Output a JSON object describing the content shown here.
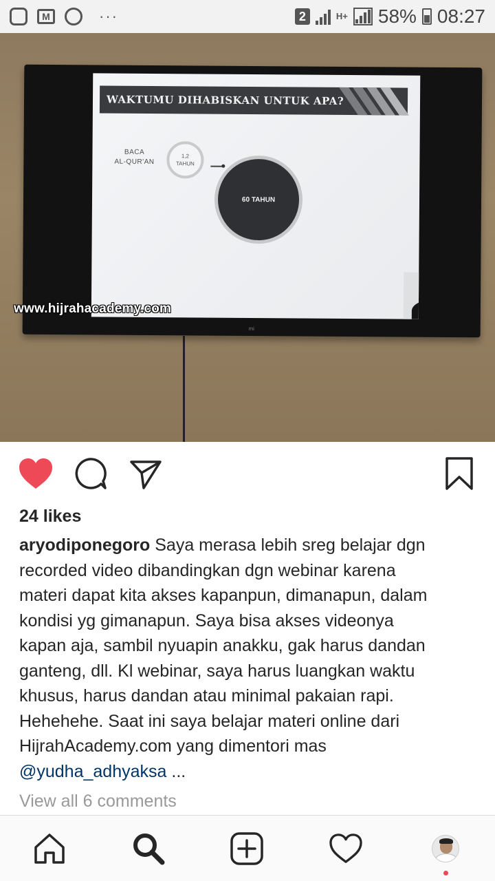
{
  "status_bar": {
    "sim_badge": "2",
    "network": "H+",
    "battery": "58%",
    "time": "08:27",
    "dots": "···",
    "icons": [
      "instagram-icon",
      "gmail-icon",
      "b-icon"
    ]
  },
  "photo": {
    "slide_title": "WAKTUMU DIHABISKAN UNTUK APA?",
    "slide_label_line1": "BACA",
    "slide_label_line2": "AL-QUR'AN",
    "small_circle_line1": "1,2",
    "small_circle_line2": "TAHUN",
    "big_circle_text": "60 TAHUN",
    "watermark": "www.hijrahacademy.com",
    "tv_brand": "mi"
  },
  "actions": {
    "like_color": "#ed4956"
  },
  "post": {
    "likes": "24 likes",
    "username": "aryodiponegoro",
    "caption_line1": " Saya merasa lebih sreg belajar dgn",
    "caption_line2": "recorded video dibandingkan dgn webinar karena",
    "caption_line3": "materi dapat kita akses kapanpun, dimanapun, dalam",
    "caption_line4": "kondisi yg gimanapun. Saya bisa akses videonya",
    "caption_line5": "kapan aja, sambil nyuapin anakku, gak harus dandan",
    "caption_line6": "ganteng, dll. Kl webinar, saya harus luangkan waktu",
    "caption_line7": "khusus, harus dandan atau minimal pakaian rapi.",
    "caption_line8": "Hehehehe. Saat ini saya belajar materi online dari",
    "caption_line9": "HijrahAcademy.com yang dimentori mas",
    "mention": "@yudha_adhyaksa",
    "more": " ...",
    "view_comments": "View all 6 comments"
  },
  "nav": {
    "items": [
      "home-icon",
      "search-icon",
      "new-post-icon",
      "activity-icon",
      "profile-avatar"
    ]
  }
}
